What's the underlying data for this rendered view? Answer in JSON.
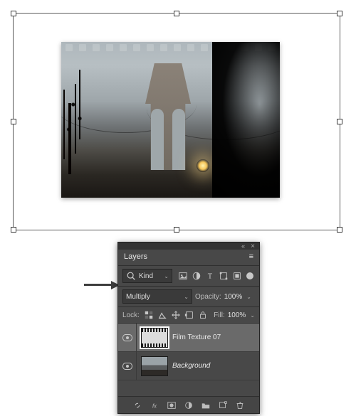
{
  "panel": {
    "title": "Layers",
    "filter": {
      "mode_label": "Kind",
      "search_icon": "search-icon",
      "filter_icons": [
        "image-filter-icon",
        "adjustment-filter-icon",
        "type-filter-icon",
        "shape-filter-icon",
        "smart-filter-icon"
      ]
    },
    "blend": {
      "mode": "Multiply",
      "opacity_label": "Opacity:",
      "opacity_value": "100%"
    },
    "lock": {
      "label": "Lock:",
      "fill_label": "Fill:",
      "fill_value": "100%",
      "icons": [
        "lock-pixels-icon",
        "lock-position-icon",
        "lock-artboard-icon",
        "lock-nested-icon",
        "lock-all-icon"
      ]
    },
    "layers": [
      {
        "name": "Film Texture 07",
        "visible": true,
        "selected": true,
        "thumb": "film",
        "italic": false
      },
      {
        "name": "Background",
        "visible": true,
        "selected": false,
        "thumb": "bridge",
        "italic": true
      }
    ],
    "bottom_icons": [
      "link-icon",
      "fx-icon",
      "mask-icon",
      "adjustment-icon",
      "group-icon",
      "new-layer-icon",
      "trash-icon"
    ]
  },
  "canvas": {
    "content": "Brooklyn Bridge with film texture"
  }
}
